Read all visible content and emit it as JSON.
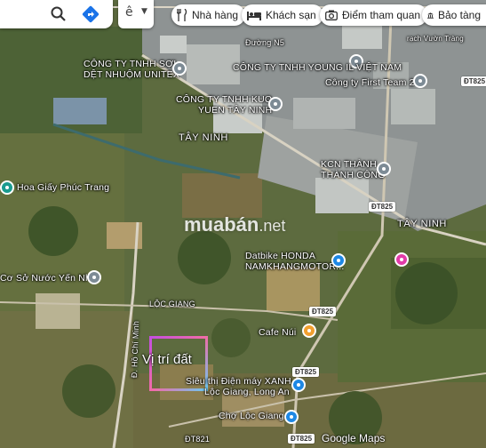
{
  "toolbar": {
    "search_icon": "search-icon",
    "directions_icon": "directions-icon",
    "lang_glyph": "ê",
    "chips": [
      {
        "label": "Nhà hàng",
        "icon": "restaurant-icon"
      },
      {
        "label": "Khách sạn",
        "icon": "hotel-icon"
      },
      {
        "label": "Điểm tham quan",
        "icon": "camera-icon"
      },
      {
        "label": "Bảo tàng",
        "icon": "museum-icon"
      }
    ]
  },
  "places": {
    "unitex_1": "CÔNG TY TNHH SỢI",
    "unitex_2": "DỆT NHUỘM UNITEX",
    "youngil": "CÔNG TY TNHH YOUNG IL VIỆT NAM",
    "first_team": "Công ty First Team 2",
    "kuo_1": "CÔNG TY TNHH KUO",
    "kuo_2": "YUEN TÂY NINH",
    "tayninh_1": "TÂY NINH",
    "kcn_1": "KCN THÀNH",
    "kcn_2": "THÀNH CÔNG",
    "hoagiay": "Hoa Giấy Phúc Trang",
    "cosonuoc": "Cơ Sở Nước Yến Nhi",
    "datbike_1": "Datbike HONDA",
    "datbike_2": "NAMKHANGMOTOR...",
    "tayninh_2": "TÂY NINH",
    "locgiang": "LỘC GIANG",
    "cafenui": "Cafe Núi",
    "sieuthi_1": "Siêu thị Điện máy XANH",
    "sieuthi_2": "Lộc Giang, Long An",
    "cholocgiang": "Chợ Lộc Giang",
    "duongn5": "Đường N5",
    "road_hcm": "Đ. Hồ Chí Minh",
    "dt821": "ĐT821",
    "vuon_trang": "rạch Vườn Tràng"
  },
  "shields": {
    "dt825_a": "ĐT825",
    "dt825_b": "ĐT825",
    "dt825_c": "ĐT825",
    "dt825_d": "ĐT825",
    "dt825_e": "ĐT825"
  },
  "overlay": {
    "watermark_main": "muabán",
    "watermark_tld": ".net",
    "vitri": "Vị trí đất",
    "google": "Google Maps"
  }
}
